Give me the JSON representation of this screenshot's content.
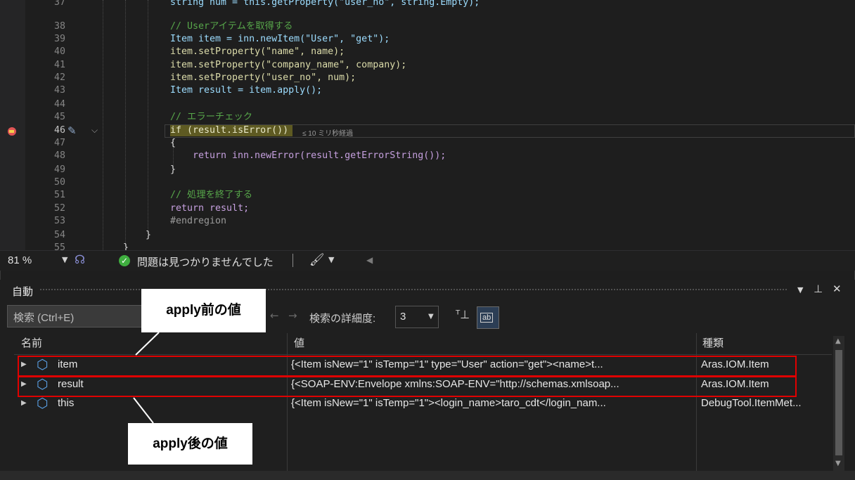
{
  "editor": {
    "lines": [
      {
        "num": "37",
        "code": "string num = this.getProperty(\"user_no\", string.Empty);"
      },
      {
        "num": "38",
        "code": "// Userアイテムを取得する"
      },
      {
        "num": "39",
        "code": "Item item = inn.newItem(\"User\", \"get\");"
      },
      {
        "num": "40",
        "code": "item.setProperty(\"name\", name);"
      },
      {
        "num": "41",
        "code": "item.setProperty(\"company_name\", company);"
      },
      {
        "num": "42",
        "code": "item.setProperty(\"user_no\", num);"
      },
      {
        "num": "43",
        "code": "Item result = item.apply();"
      },
      {
        "num": "44",
        "code": ""
      },
      {
        "num": "45",
        "code": "// エラーチェック"
      },
      {
        "num": "46",
        "code": "if (result.isError())"
      },
      {
        "num": "47",
        "code": "{"
      },
      {
        "num": "48",
        "code": "return inn.newError(result.getErrorString());"
      },
      {
        "num": "49",
        "code": "}"
      },
      {
        "num": "50",
        "code": ""
      },
      {
        "num": "51",
        "code": "// 処理を終了する"
      },
      {
        "num": "52",
        "code": "return result;"
      },
      {
        "num": "53",
        "code": "#endregion"
      },
      {
        "num": "54",
        "code": "}"
      },
      {
        "num": "55",
        "code": "}"
      }
    ],
    "elapsed_hint": "≤ 10 ミリ秒経過"
  },
  "status": {
    "zoom": "81 %",
    "message": "問題は見つかりませんでした"
  },
  "panel": {
    "title": "自動",
    "search_placeholder": "検索 (Ctrl+E)",
    "depth_label": "検索の詳細度:",
    "depth_value": "3",
    "hex_label": "ab"
  },
  "grid": {
    "columns": [
      "名前",
      "値",
      "種類"
    ],
    "rows": [
      {
        "name": "item",
        "value": "{<Item isNew=\"1\" isTemp=\"1\" type=\"User\" action=\"get\"><name>t...",
        "type": "Aras.IOM.Item"
      },
      {
        "name": "result",
        "value": "{<SOAP-ENV:Envelope xmlns:SOAP-ENV=\"http://schemas.xmlsoap...",
        "type": "Aras.IOM.Item"
      },
      {
        "name": "this",
        "value": "{<Item isNew=\"1\" isTemp=\"1\"><login_name>taro_cdt</login_nam...",
        "type": "DebugTool.ItemMet..."
      }
    ]
  },
  "annotations": {
    "before": "apply前の値",
    "after": "apply後の値",
    "highlight_color": "#e00000"
  }
}
